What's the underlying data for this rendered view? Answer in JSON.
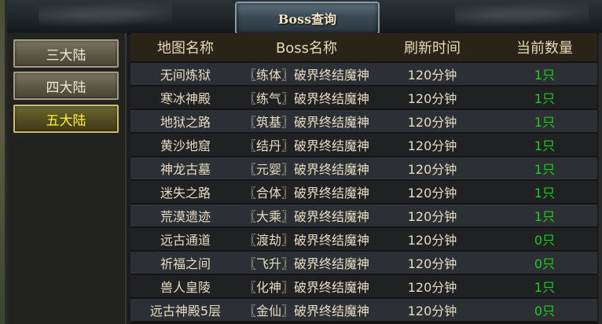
{
  "window": {
    "title": "Boss查询"
  },
  "sidebar": {
    "items": [
      {
        "label": "三大陆",
        "active": false
      },
      {
        "label": "四大陆",
        "active": false
      },
      {
        "label": "五大陆",
        "active": true
      }
    ]
  },
  "table": {
    "headers": [
      "地图名称",
      "Boss名称",
      "刷新时间",
      "当前数量"
    ],
    "rows": [
      {
        "map": "无间炼狱",
        "boss": "〖练体〗破界终结魔神",
        "time": "120分钟",
        "count": "1只"
      },
      {
        "map": "寒冰神殿",
        "boss": "〖练气〗破界终结魔神",
        "time": "120分钟",
        "count": "1只"
      },
      {
        "map": "地狱之路",
        "boss": "〖筑基〗破界终结魔神",
        "time": "120分钟",
        "count": "1只"
      },
      {
        "map": "黄沙地窟",
        "boss": "〖结丹〗破界终结魔神",
        "time": "120分钟",
        "count": "1只"
      },
      {
        "map": "神龙古墓",
        "boss": "〖元婴〗破界终结魔神",
        "time": "120分钟",
        "count": "1只"
      },
      {
        "map": "迷失之路",
        "boss": "〖合体〗破界终结魔神",
        "time": "120分钟",
        "count": "1只"
      },
      {
        "map": "荒漠遗迹",
        "boss": "〖大乘〗破界终结魔神",
        "time": "120分钟",
        "count": "1只"
      },
      {
        "map": "远古通道",
        "boss": "〖渡劫〗破界终结魔神",
        "time": "120分钟",
        "count": "0只"
      },
      {
        "map": "祈福之间",
        "boss": "〖飞升〗破界终结魔神",
        "time": "120分钟",
        "count": "0只"
      },
      {
        "map": "兽人皇陵",
        "boss": "〖化神〗破界终结魔神",
        "time": "120分钟",
        "count": "1只"
      },
      {
        "map": "远古神殿5层",
        "boss": "〖金仙〗破界终结魔神",
        "time": "120分钟",
        "count": "0只"
      }
    ]
  },
  "colors": {
    "count": "#1bd11b",
    "active_tab_text": "#ffef3a",
    "header_text": "#e9d8b5",
    "row_text": "#e6dbc2"
  }
}
